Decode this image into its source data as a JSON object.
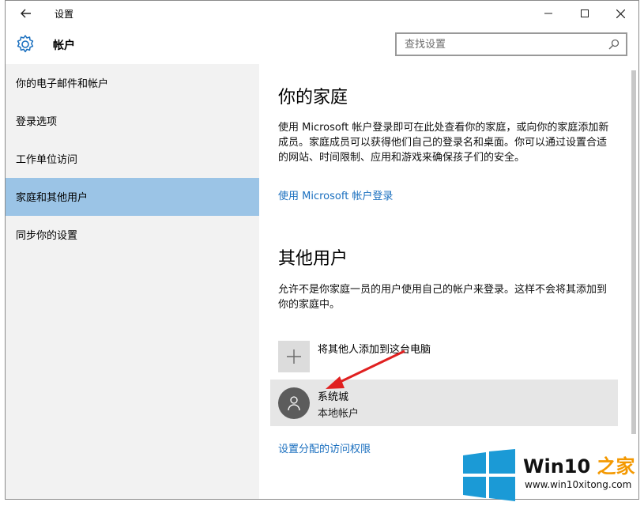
{
  "window": {
    "title": "设置"
  },
  "header": {
    "title": "帐户"
  },
  "search": {
    "placeholder": "查找设置"
  },
  "sidebar": {
    "items": [
      {
        "label": "你的电子邮件和帐户"
      },
      {
        "label": "登录选项"
      },
      {
        "label": "工作单位访问"
      },
      {
        "label": "家庭和其他用户",
        "selected": true
      },
      {
        "label": "同步你的设置"
      }
    ]
  },
  "family": {
    "heading": "你的家庭",
    "description": "使用 Microsoft 帐户登录即可在此处查看你的家庭，或向你的家庭添加新成员。家庭成员可以获得他们自己的登录名和桌面。你可以通过设置合适的网站、时间限制、应用和游戏来确保孩子们的安全。",
    "signin_link": "使用 Microsoft 帐户登录"
  },
  "others": {
    "heading": "其他用户",
    "description": "允许不是你家庭一员的用户使用自己的帐户来登录。这样不会将其添加到你的家庭中。",
    "add_label": "将其他人添加到这台电脑",
    "user": {
      "name": "系统城",
      "type": "本地帐户"
    },
    "access_link": "设置分配的访问权限"
  },
  "watermark": {
    "brand": "Win10",
    "brand_suffix": "之家",
    "url": "www.win10xitong.com"
  },
  "colors": {
    "accent": "#1a6fbf",
    "selected": "#9bc4e6",
    "sidebar_bg": "#f2f2f2",
    "arrow": "#e02020"
  },
  "icons": [
    "back-arrow-icon",
    "gear-icon",
    "search-icon",
    "minimize-icon",
    "maximize-icon",
    "close-icon",
    "plus-icon",
    "person-icon",
    "windows-logo-icon"
  ]
}
